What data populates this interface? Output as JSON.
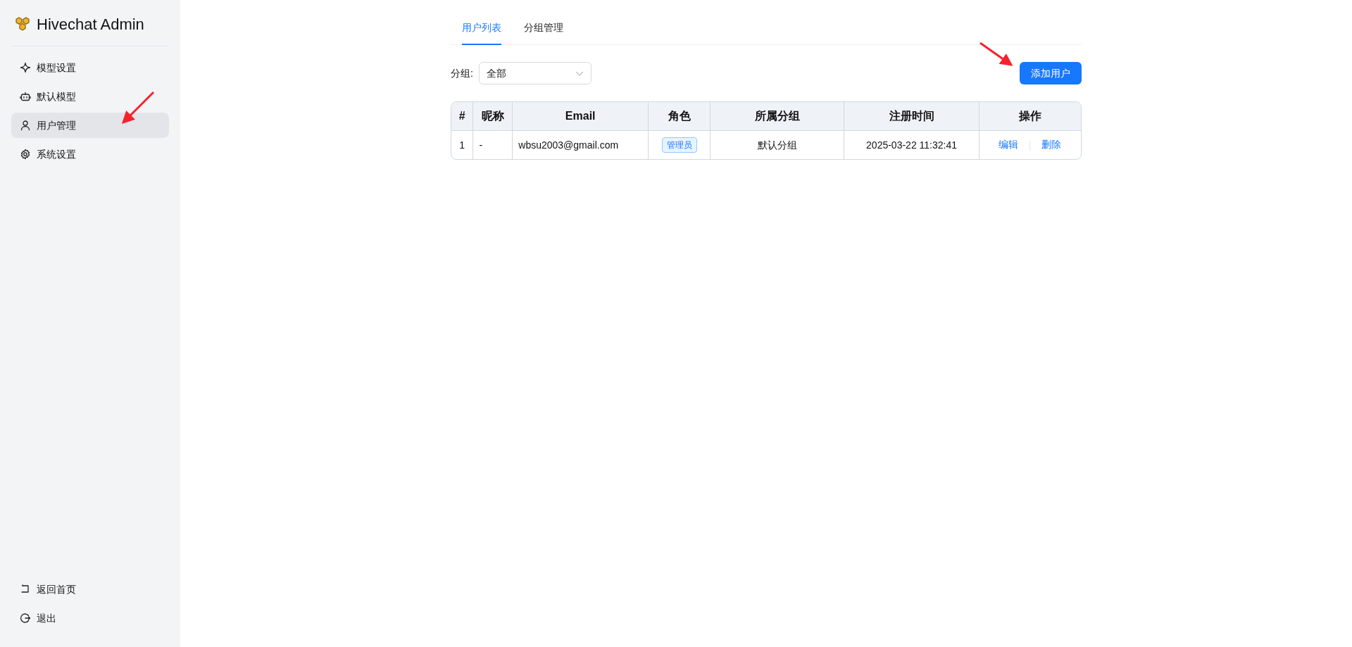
{
  "sidebar": {
    "title": "Hivechat Admin",
    "items": [
      {
        "label": "模型设置",
        "selected": false
      },
      {
        "label": "默认模型",
        "selected": false
      },
      {
        "label": "用户管理",
        "selected": true
      },
      {
        "label": "系统设置",
        "selected": false
      }
    ],
    "footer_items": [
      {
        "label": "返回首页"
      },
      {
        "label": "退出"
      }
    ]
  },
  "tabs": [
    {
      "label": "用户列表",
      "selected": true
    },
    {
      "label": "分组管理",
      "selected": false
    }
  ],
  "filter": {
    "label": "分组:",
    "value": "全部"
  },
  "add_button": "添加用户",
  "table": {
    "columns": [
      "#",
      "昵称",
      "Email",
      "角色",
      "所属分组",
      "注册时间",
      "操作"
    ],
    "rows": [
      {
        "index": "1",
        "nickname": "-",
        "email": "wbsu2003@gmail.com",
        "role": "管理员",
        "group": "默认分组",
        "registered": "2025-03-22 11:32:41",
        "actions": [
          "编辑",
          "删除"
        ]
      }
    ]
  }
}
